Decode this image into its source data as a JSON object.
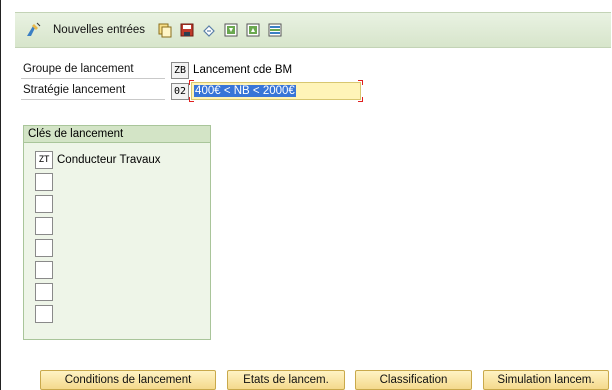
{
  "toolbar": {
    "new_entries_label": "Nouvelles entrées",
    "icons": [
      "new-entries-icon",
      "copy-icon",
      "save-icon",
      "undo-icon",
      "first-page-icon",
      "last-page-icon",
      "overview-icon"
    ]
  },
  "fields": {
    "groupe_label": "Groupe de lancement",
    "groupe_code": "ZB",
    "groupe_desc": "Lancement cde BM",
    "strategie_label": "Stratégie lancement",
    "strategie_code": "02",
    "strategie_value": "400€ < NB < 2000€"
  },
  "release_keys": {
    "title": "Clés de lancement",
    "items": [
      {
        "code": "ZT",
        "label": "Conducteur Travaux"
      },
      {
        "code": "",
        "label": ""
      },
      {
        "code": "",
        "label": ""
      },
      {
        "code": "",
        "label": ""
      },
      {
        "code": "",
        "label": ""
      },
      {
        "code": "",
        "label": ""
      },
      {
        "code": "",
        "label": ""
      },
      {
        "code": "",
        "label": ""
      }
    ]
  },
  "buttons": {
    "conditions": "Conditions de lancement",
    "etats": "Etats de lancem.",
    "classification": "Classification",
    "simulation": "Simulation lancem."
  },
  "colors": {
    "toolbar_bg": "#d7e5cb",
    "group_bg": "#eef5e8",
    "button_bg": "#f4d98c",
    "input_highlight": "#fff4b8",
    "selection": "#3875d7"
  }
}
